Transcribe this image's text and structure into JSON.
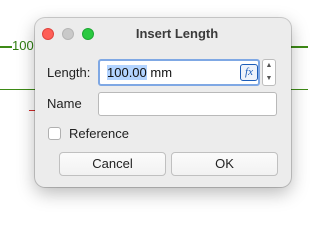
{
  "background": {
    "dimension_text": "100"
  },
  "dialog": {
    "title": "Insert Length",
    "window_controls": {
      "close_icon": "red-circle",
      "minimize_icon": "gray-circle",
      "maximize_icon": "green-circle"
    },
    "length": {
      "label": "Length:",
      "value": "100.00",
      "unit": " mm",
      "formula_icon_text": "fx",
      "stepper_up": "▲",
      "stepper_down": "▼"
    },
    "name": {
      "label": "Name",
      "value": ""
    },
    "reference": {
      "label": "Reference",
      "checked": false
    },
    "buttons": {
      "cancel": "Cancel",
      "ok": "OK"
    }
  },
  "colors": {
    "sketch_green": "#2e7d10",
    "focus_blue": "#7fa8e4",
    "selection_blue": "#b3d4ff",
    "close_red": "#fe5f57",
    "maximize_green": "#2ac940"
  }
}
